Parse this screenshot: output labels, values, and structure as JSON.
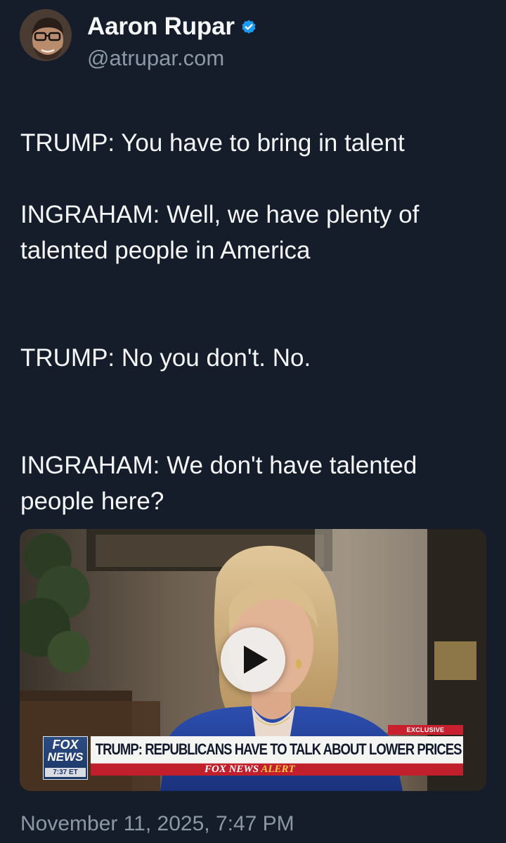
{
  "author": {
    "display_name": "Aaron Rupar",
    "handle": "@atrupar.com",
    "verified": true,
    "verified_color": "#1d9bf0",
    "avatar_icon": "profile-photo"
  },
  "post": {
    "lines": [
      "TRUMP: You have to bring in talent",
      "INGRAHAM: Well, we have plenty of",
      "talented people in America",
      "TRUMP: No you don't. No.",
      "INGRAHAM: We don't have talented",
      "people here?"
    ]
  },
  "media": {
    "type": "video",
    "play_icon": "play-icon",
    "chyron": {
      "logo_line_1": "FOX",
      "logo_line_2": "NEWS",
      "logo_time": "7:37 ET",
      "tag": "EXCLUSIVE",
      "headline": "TRUMP: REPUBLICANS HAVE TO TALK ABOUT LOWER PRICES",
      "alert_part_1": "FOX NEWS",
      "alert_part_2": "ALERT"
    }
  },
  "timestamp": "November 11, 2025, 7:47 PM",
  "colors": {
    "background": "#161d2a",
    "primary_text": "#f5f7f9",
    "secondary_text": "#8b98a5"
  }
}
